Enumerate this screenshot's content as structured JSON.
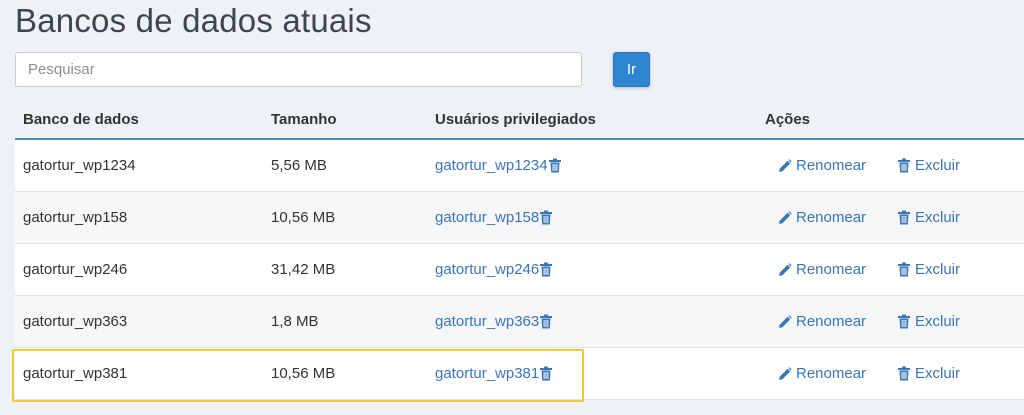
{
  "page": {
    "title": "Bancos de dados atuais"
  },
  "search": {
    "placeholder": "Pesquisar",
    "value": "",
    "button_label": "Ir"
  },
  "table": {
    "headers": {
      "database": "Banco de dados",
      "size": "Tamanho",
      "users": "Usuários privilegiados",
      "actions": "Ações"
    },
    "rename_label": "Renomear",
    "delete_label": "Excluir",
    "rows": [
      {
        "database": "gatortur_wp1234",
        "size": "5,56 MB",
        "user": "gatortur_wp1234"
      },
      {
        "database": "gatortur_wp158",
        "size": "10,56 MB",
        "user": "gatortur_wp158"
      },
      {
        "database": "gatortur_wp246",
        "size": "31,42 MB",
        "user": "gatortur_wp246"
      },
      {
        "database": "gatortur_wp363",
        "size": "1,8 MB",
        "user": "gatortur_wp363"
      },
      {
        "database": "gatortur_wp381",
        "size": "10,56 MB",
        "user": "gatortur_wp381"
      }
    ]
  },
  "icons": {
    "trash": "trash-icon",
    "pencil": "pencil-icon"
  },
  "colors": {
    "link": "#3a76b5",
    "button": "#2f84cf",
    "highlight": "#f0c838",
    "header_rule": "#4f87c1"
  }
}
